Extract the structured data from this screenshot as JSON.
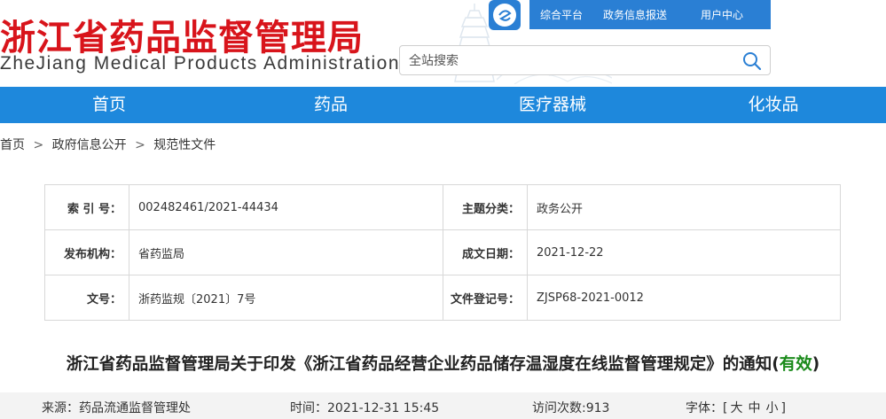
{
  "header": {
    "title_cn": "浙江省药品监督管理局",
    "title_en": "ZheJiang Medical Products Administration",
    "colors": {
      "title_red": "#d8141b",
      "brand_blue": "#1e88dc",
      "valid_green": "#1a8a1a"
    },
    "logo_icon": "zhejiang-logo-icon",
    "top_links": [
      "综合平台",
      "政务信息报送",
      "用户中心"
    ],
    "search": {
      "placeholder": "全站搜索",
      "icon": "search-icon"
    }
  },
  "nav": [
    "首页",
    "药品",
    "医疗器械",
    "化妆品"
  ],
  "breadcrumb": [
    "首页",
    "政府信息公开",
    "规范性文件"
  ],
  "breadcrumb_separator": ">",
  "meta": {
    "rows": [
      {
        "l1": "索 引 号：",
        "v1": "002482461/2021-44434",
        "l2": "主题分类：",
        "v2": "政务公开"
      },
      {
        "l1": "发布机构：",
        "v1": "省药监局",
        "l2": "成文日期：",
        "v2": "2021-12-22"
      },
      {
        "l1": "文号：",
        "v1": "浙药监规〔2021〕7号",
        "l2": "文件登记号：",
        "v2": "ZJSP68-2021-0012"
      }
    ]
  },
  "document": {
    "title": "浙江省药品监督管理局关于印发《浙江省药品经营企业药品储存温湿度在线监督管理规定》的通知",
    "status": "有效"
  },
  "infobar": {
    "source": "来源：药品流通监督管理处",
    "time": "时间：2021-12-31 15:45",
    "visits": "访问次数:913",
    "font_label": "字体：[",
    "font_large": "大",
    "font_medium": "中",
    "font_small": "小",
    "font_end": "]"
  }
}
